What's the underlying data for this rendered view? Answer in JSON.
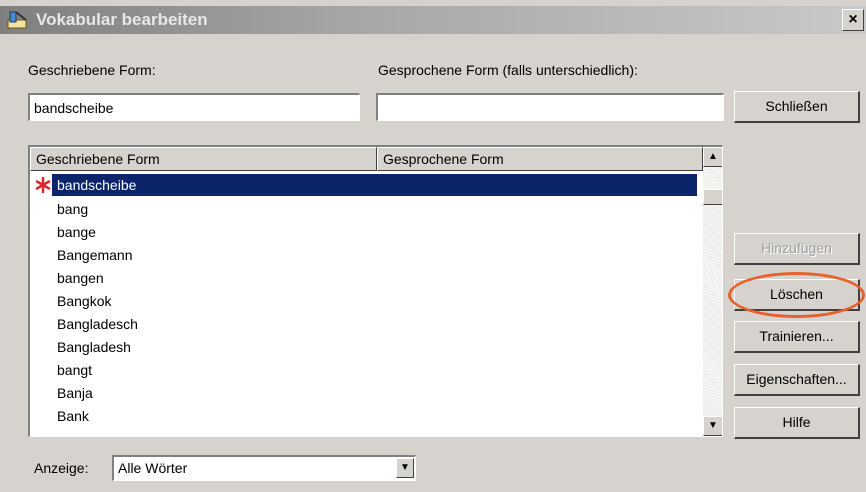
{
  "window": {
    "title": "Vokabular bearbeiten",
    "close_label": "×"
  },
  "fields": {
    "written_label": "Geschriebene Form:",
    "written_value": "bandscheibe",
    "spoken_label": "Gesprochene Form (falls unterschiedlich):",
    "spoken_value": ""
  },
  "buttons": {
    "close": "Schließen",
    "add": "Hinzufügen",
    "delete": "Löschen",
    "train": "Trainieren...",
    "properties": "Eigenschaften...",
    "help": "Hilfe"
  },
  "list": {
    "col_written": "Geschriebene Form",
    "col_spoken": "Gesprochene Form",
    "items": [
      "bandscheibe",
      "bang",
      "bange",
      "Bangemann",
      "bangen",
      "Bangkok",
      "Bangladesch",
      "Bangladesh",
      "bangt",
      "Banja",
      "Bank"
    ],
    "selected_index": 0,
    "marker_icon": "asterisk-icon"
  },
  "filter": {
    "label": "Anzeige:",
    "value": "Alle Wörter"
  },
  "colors": {
    "selection": "#0b246a",
    "highlight_ring": "#e8602c",
    "dialog_bg": "#d6d3ce"
  }
}
